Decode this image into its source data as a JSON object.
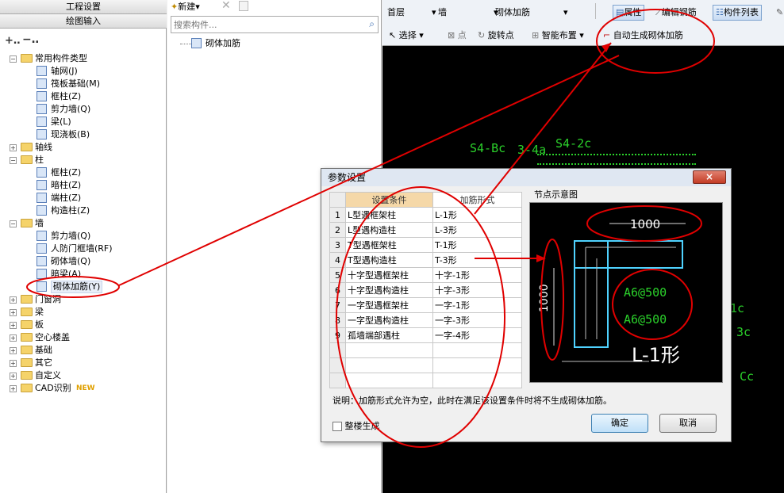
{
  "left": {
    "tab1": "工程设置",
    "tab2": "绘图输入",
    "tree": [
      {
        "label": "常用构件类型",
        "level": 0,
        "folder": true,
        "open": true
      },
      {
        "label": "轴网(J)",
        "level": 1
      },
      {
        "label": "筏板基础(M)",
        "level": 1
      },
      {
        "label": "框柱(Z)",
        "level": 1
      },
      {
        "label": "剪力墙(Q)",
        "level": 1
      },
      {
        "label": "梁(L)",
        "level": 1
      },
      {
        "label": "现浇板(B)",
        "level": 1
      },
      {
        "label": "轴线",
        "level": 0,
        "folder": true
      },
      {
        "label": "柱",
        "level": 0,
        "folder": true,
        "open": true
      },
      {
        "label": "框柱(Z)",
        "level": 1
      },
      {
        "label": "暗柱(Z)",
        "level": 1
      },
      {
        "label": "端柱(Z)",
        "level": 1
      },
      {
        "label": "构造柱(Z)",
        "level": 1
      },
      {
        "label": "墙",
        "level": 0,
        "folder": true,
        "open": true
      },
      {
        "label": "剪力墙(Q)",
        "level": 1
      },
      {
        "label": "人防门框墙(RF)",
        "level": 1
      },
      {
        "label": "砌体墙(Q)",
        "level": 1
      },
      {
        "label": "暗梁(A)",
        "level": 1
      },
      {
        "label": "砌体加筋(Y)",
        "level": 1,
        "selected": true
      },
      {
        "label": "门窗洞",
        "level": 0,
        "folder": true
      },
      {
        "label": "梁",
        "level": 0,
        "folder": true
      },
      {
        "label": "板",
        "level": 0,
        "folder": true
      },
      {
        "label": "空心楼盖",
        "level": 0,
        "folder": true
      },
      {
        "label": "基础",
        "level": 0,
        "folder": true
      },
      {
        "label": "其它",
        "level": 0,
        "folder": true
      },
      {
        "label": "自定义",
        "level": 0,
        "folder": true
      },
      {
        "label": "CAD识别",
        "level": 0,
        "folder": true,
        "badge": "NEW"
      }
    ]
  },
  "mid": {
    "new_label": "新建",
    "search_placeholder": "搜索构件...",
    "item": "砌体加筋"
  },
  "toolbar": {
    "floor": "首层",
    "type": "墙",
    "sub": "砌体加筋",
    "attr": "属性",
    "edit_rebar": "编辑钢筋",
    "comp_list": "构件列表",
    "select": "选择",
    "point": "点",
    "rotate_point": "旋转点",
    "smart_layout": "智能布置",
    "auto_gen": "自动生成砌体加筋"
  },
  "cad": {
    "labels": [
      "S4-Bc",
      "3-4a",
      "S4-2c",
      "1c",
      "3c",
      "Cc"
    ]
  },
  "dialog": {
    "title": "参数设置",
    "col1": "设置条件",
    "col2": "加筋形式",
    "node_title": "节点示意图",
    "rows": [
      {
        "n": "1",
        "cond": "L型遇框架柱",
        "form": "L-1形"
      },
      {
        "n": "2",
        "cond": "L型遇构造柱",
        "form": "L-3形"
      },
      {
        "n": "3",
        "cond": "T型遇框架柱",
        "form": "T-1形"
      },
      {
        "n": "4",
        "cond": "T型遇构造柱",
        "form": "T-3形"
      },
      {
        "n": "5",
        "cond": "十字型遇框架柱",
        "form": "十字-1形"
      },
      {
        "n": "6",
        "cond": "十字型遇构造柱",
        "form": "十字-3形"
      },
      {
        "n": "7",
        "cond": "一字型遇框架柱",
        "form": "一字-1形"
      },
      {
        "n": "8",
        "cond": "一字型遇构造柱",
        "form": "一字-3形"
      },
      {
        "n": "9",
        "cond": "孤墙端部遇柱",
        "form": "一字-4形"
      }
    ],
    "dim_h": "1000",
    "dim_v": "1000",
    "rebar1": "A6@500",
    "rebar2": "A6@500",
    "shape": "L-1形",
    "note": "说明：加筋形式允许为空，此时在满足该设置条件时将不生成砌体加筋。",
    "whole_floor": "整楼生成",
    "ok": "确定",
    "cancel": "取消",
    "close": "×"
  },
  "colors": {
    "annot": "#e00000",
    "cad_green": "#2bd12b",
    "header": "#f5d8a8"
  }
}
